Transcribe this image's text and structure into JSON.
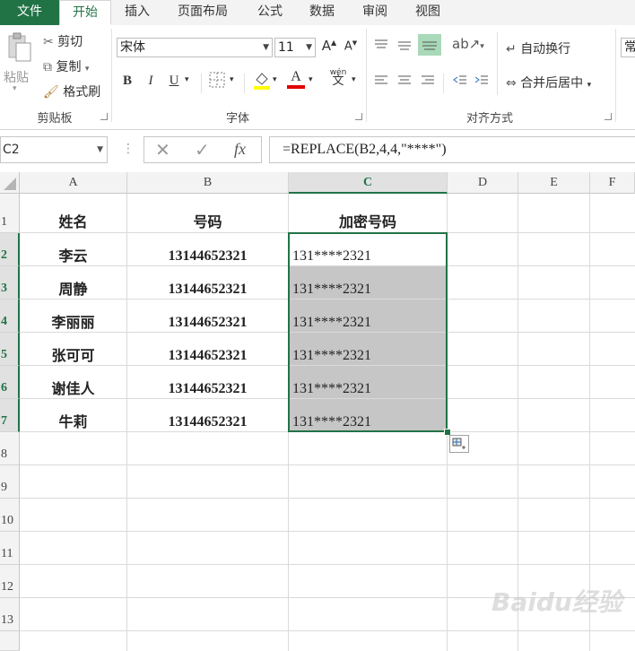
{
  "ribbon": {
    "tabs": [
      "文件",
      "开始",
      "插入",
      "页面布局",
      "公式",
      "数据",
      "审阅",
      "视图"
    ],
    "clipboard": {
      "paste": "粘贴",
      "cut": "剪切",
      "copy": "复制",
      "format_painter": "格式刷",
      "group": "剪贴板"
    },
    "font": {
      "name": "宋体",
      "size": "11",
      "bold": "B",
      "italic": "I",
      "underline": "U",
      "group": "字体",
      "grow": "A",
      "shrink": "A",
      "pinyin": "wén",
      "pinyin_char": "文",
      "fill_letter": "A"
    },
    "alignment": {
      "wrap_text": "自动换行",
      "merge_center": "合并后居中",
      "group": "对齐方式"
    },
    "number_partial": "常"
  },
  "formula_bar": {
    "name_box": "C2",
    "fx": "fx",
    "formula": "=REPLACE(B2,4,4,\"****\")"
  },
  "sheet": {
    "columns": [
      "A",
      "B",
      "C",
      "D",
      "E",
      "F"
    ],
    "rows": [
      "1",
      "2",
      "3",
      "4",
      "5",
      "6",
      "7",
      "8",
      "9",
      "10",
      "11",
      "12",
      "13"
    ],
    "headers": [
      "姓名",
      "号码",
      "加密号码"
    ],
    "data": [
      {
        "name": "李云",
        "number": "13144652321",
        "encrypted": "131****2321"
      },
      {
        "name": "周静",
        "number": "13144652321",
        "encrypted": "131****2321"
      },
      {
        "name": "李丽丽",
        "number": "13144652321",
        "encrypted": "131****2321"
      },
      {
        "name": "张可可",
        "number": "13144652321",
        "encrypted": "131****2321"
      },
      {
        "name": "谢佳人",
        "number": "13144652321",
        "encrypted": "131****2321"
      },
      {
        "name": "牛莉",
        "number": "13144652321",
        "encrypted": "131****2321"
      }
    ],
    "selected_cell": "C2"
  },
  "watermark": "Baidu经验",
  "colors": {
    "accent": "#217346",
    "selection_fill": "#c6c6c6"
  }
}
